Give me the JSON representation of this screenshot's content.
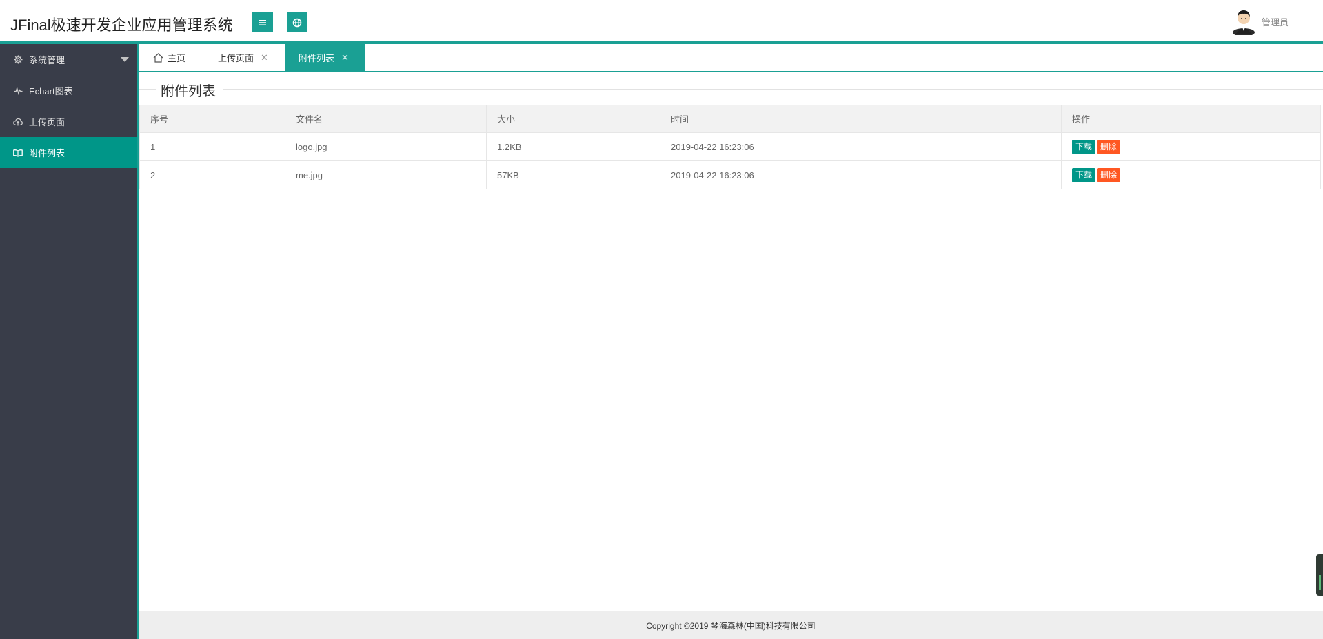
{
  "header": {
    "title": "JFinal极速开发企业应用管理系统",
    "menu_icon": "hamburger-icon",
    "globe_icon": "globe-icon",
    "user_name": "管理员",
    "accent": "#1aa094"
  },
  "sidebar": {
    "items": [
      {
        "label": "系统管理",
        "icon": "gear-icon",
        "active": false,
        "has_caret": true
      },
      {
        "label": "Echart图表",
        "icon": "chart-pulse-icon",
        "active": false
      },
      {
        "label": "上传页面",
        "icon": "cloud-upload-icon",
        "active": false
      },
      {
        "label": "附件列表",
        "icon": "book-icon",
        "active": true
      }
    ]
  },
  "tabs": [
    {
      "label": "主页",
      "icon": "home-icon",
      "closable": false,
      "active": false
    },
    {
      "label": "上传页面",
      "closable": true,
      "active": false
    },
    {
      "label": "附件列表",
      "closable": true,
      "active": true
    }
  ],
  "main": {
    "section_title": "附件列表",
    "table": {
      "headers": [
        "序号",
        "文件名",
        "大小",
        "时间",
        "操作"
      ],
      "rows": [
        {
          "no": "1",
          "name": "logo.jpg",
          "size": "1.2KB",
          "time": "2019-04-22 16:23:06"
        },
        {
          "no": "2",
          "name": "me.jpg",
          "size": "57KB",
          "time": "2019-04-22 16:23:06"
        }
      ],
      "download_label": "下载",
      "delete_label": "删除"
    }
  },
  "footer": {
    "copyright": "Copyright ©2019 琴海森林(中国)科技有限公司"
  }
}
